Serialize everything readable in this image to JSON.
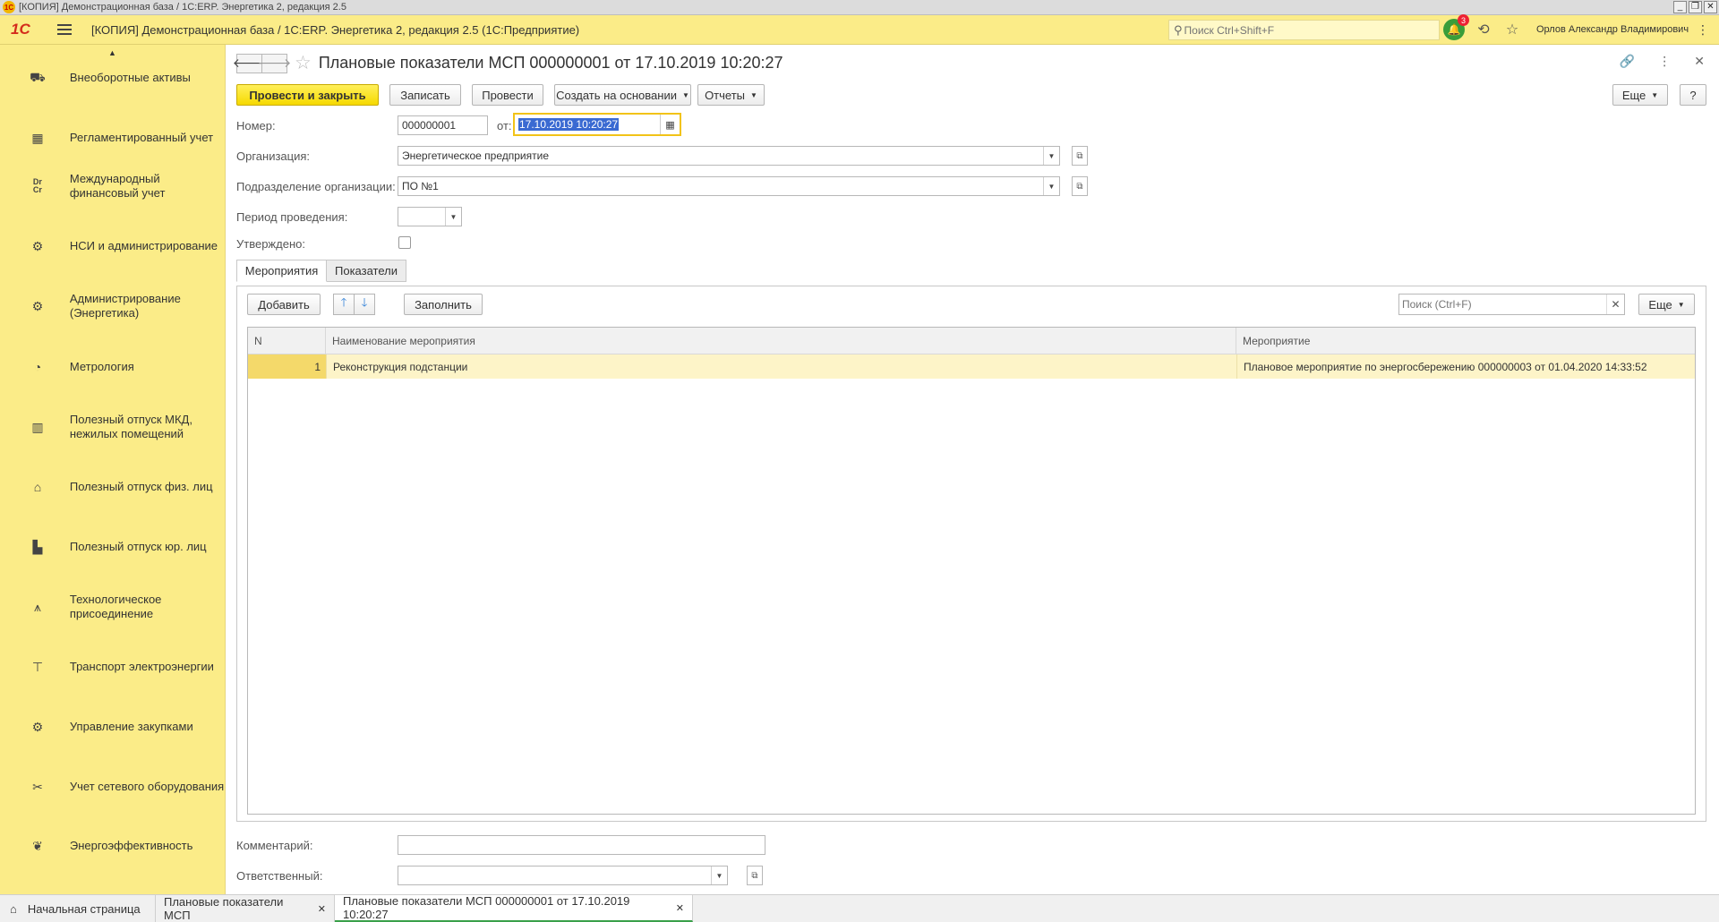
{
  "window": {
    "title": "[КОПИЯ] Демонстрационная база / 1С:ERP. Энергетика 2, редакция 2.5",
    "logo": "1С",
    "controls": [
      "_",
      "❐",
      "✕"
    ]
  },
  "header": {
    "logo": "1С",
    "title": "[КОПИЯ] Демонстрационная база / 1С:ERP. Энергетика 2, редакция 2.5  (1С:Предприятие)",
    "search_placeholder": "Поиск Ctrl+Shift+F",
    "notifications_count": "3",
    "user": "Орлов Александр Владимирович"
  },
  "sidebar": {
    "items": [
      {
        "icon": "car-icon",
        "glyph": "🚗",
        "label": "Внеоборотные активы"
      },
      {
        "icon": "calculator-icon",
        "glyph": "▦",
        "label": "Регламентированный учет"
      },
      {
        "icon": "drcr-icon",
        "glyph": "Dr Cr",
        "label": "Международный финансовый учет"
      },
      {
        "icon": "gear-icon",
        "glyph": "⚙",
        "label": "НСИ и администрирование"
      },
      {
        "icon": "gear-icon",
        "glyph": "⚙",
        "label": "Администрирование (Энергетика)"
      },
      {
        "icon": "gauge-icon",
        "glyph": "◔",
        "label": "Метрология"
      },
      {
        "icon": "building-icon",
        "glyph": "▥",
        "label": "Полезный отпуск МКД, нежилых помещений"
      },
      {
        "icon": "house-icon",
        "glyph": "⌂",
        "label": "Полезный отпуск физ. лиц"
      },
      {
        "icon": "factory-icon",
        "glyph": "⌂",
        "label": "Полезный отпуск юр. лиц"
      },
      {
        "icon": "power-tower-icon",
        "glyph": "⚡",
        "label": "Технологическое присоединение"
      },
      {
        "icon": "pole-icon",
        "glyph": "⊤",
        "label": "Транспорт электроэнергии"
      },
      {
        "icon": "procurement-icon",
        "glyph": "⚙",
        "label": "Управление закупками"
      },
      {
        "icon": "tools-icon",
        "glyph": "✂",
        "label": "Учет сетевого оборудования"
      },
      {
        "icon": "leaf-icon",
        "glyph": "❦",
        "label": "Энергоэффективность"
      }
    ]
  },
  "document": {
    "title": "Плановые показатели МСП 000000001 от 17.10.2019 10:20:27",
    "toolbar": {
      "post_close": "Провести и закрыть",
      "save": "Записать",
      "post": "Провести",
      "create_based": "Создать на основании",
      "reports": "Отчеты",
      "more": "Еще",
      "help": "?"
    },
    "fields": {
      "number_label": "Номер:",
      "number_value": "000000001",
      "date_label": "от:",
      "date_value": "17.10.2019 10:20:27",
      "org_label": "Организация:",
      "org_value": "Энергетическое предприятие",
      "dept_label": "Подразделение организации:",
      "dept_value": "ПО №1",
      "period_label": "Период проведения:",
      "period_value": "",
      "approved_label": "Утверждено:",
      "approved": false,
      "comment_label": "Комментарий:",
      "comment_value": "",
      "responsible_label": "Ответственный:",
      "responsible_value": ""
    },
    "tabs": [
      {
        "label": "Мероприятия",
        "active": true
      },
      {
        "label": "Показатели",
        "active": false
      }
    ],
    "table_toolbar": {
      "add": "Добавить",
      "fill": "Заполнить",
      "search_placeholder": "Поиск (Ctrl+F)",
      "more": "Еще"
    },
    "table": {
      "columns": [
        "N",
        "Наименование мероприятия",
        "Мероприятие"
      ],
      "rows": [
        [
          "1",
          "Реконструкция подстанции",
          "Плановое мероприятие по энергосбережению 000000003 от 01.04.2020 14:33:52"
        ]
      ]
    }
  },
  "bottom_tabs": [
    {
      "label": "Начальная страница"
    },
    {
      "label": "Плановые показатели МСП"
    },
    {
      "label": "Плановые показатели МСП 000000001 от 17.10.2019 10:20:27"
    }
  ],
  "colors": {
    "accent_yellow": "#fbec88",
    "primary_button": "#f6d900",
    "selection_blue": "#3a6ad2",
    "row_highlight": "#fdf4c8"
  }
}
